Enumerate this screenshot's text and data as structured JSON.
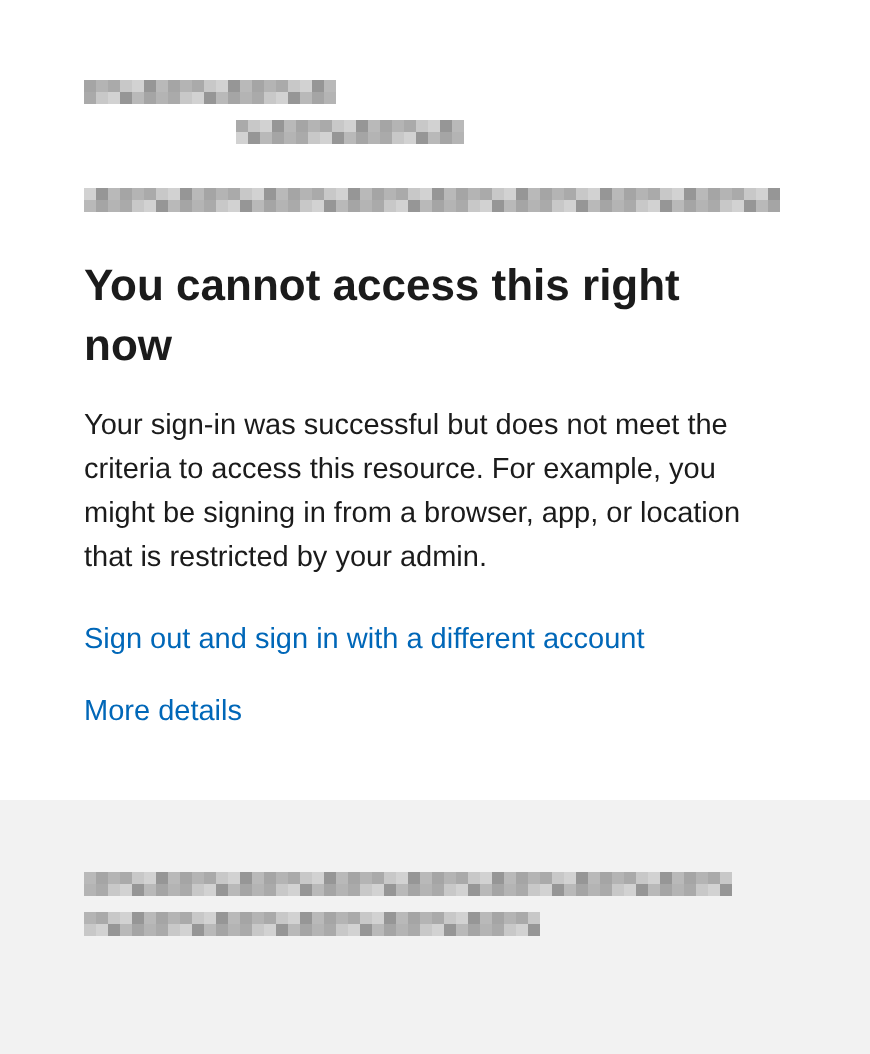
{
  "heading": "You cannot access this right now",
  "message": "Your sign-in was successful but does not meet the criteria to access this resource. For example, you might be signing in from a browser, app, or location that is restricted by your admin.",
  "links": [
    {
      "label": "Sign out and sign in with a different account"
    },
    {
      "label": "More details"
    }
  ]
}
